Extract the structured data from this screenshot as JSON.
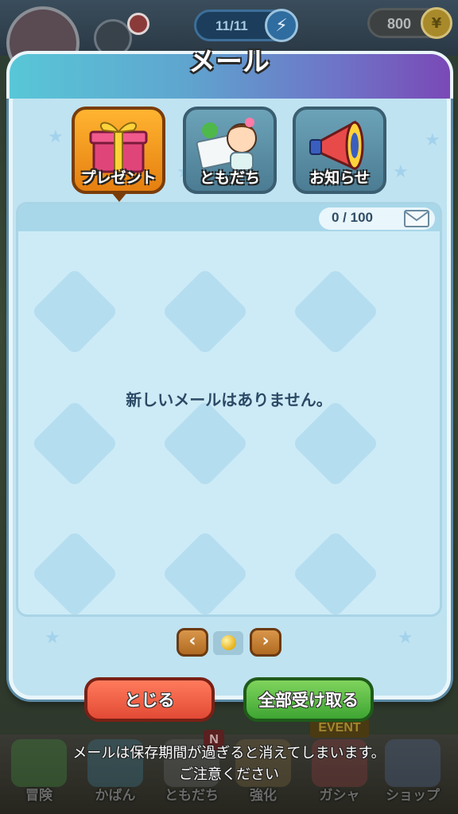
{
  "status_bar": {
    "stamina": "11/11",
    "stamina_icon": "lightning-icon",
    "coins": "800",
    "coin_icon": "yen-coin-icon"
  },
  "modal": {
    "title": "メール",
    "tabs": [
      {
        "label": "プレゼント",
        "icon": "gift-box-icon",
        "active": true
      },
      {
        "label": "ともだち",
        "icon": "friend-letter-icon",
        "active": false
      },
      {
        "label": "お知らせ",
        "icon": "megaphone-icon",
        "active": false
      }
    ],
    "mail_count": "0 / 100",
    "mail_count_icon": "envelope-icon",
    "empty_message": "新しいメールはありません。",
    "pager": {
      "prev_label": "‹",
      "next_label": "›",
      "current_page": 1,
      "total_pages": 1
    },
    "close_button": "とじる",
    "claim_all_button": "全部受け取る",
    "notice_line1": "メールは保存期間が過ぎると消えてしまいます。",
    "notice_line2": "ご注意ください"
  },
  "bottom_nav": {
    "items": [
      {
        "label": "冒険",
        "icon": "map-icon"
      },
      {
        "label": "かばん",
        "icon": "bag-icon"
      },
      {
        "label": "ともだち",
        "icon": "friends-icon"
      },
      {
        "label": "強化",
        "icon": "powerup-icon"
      },
      {
        "label": "ガシャ",
        "icon": "gacha-icon"
      },
      {
        "label": "ショップ",
        "icon": "shop-icon"
      }
    ],
    "event_badge": "EVENT",
    "new_badge": "N"
  },
  "colors": {
    "header_gradient_start": "#58c7d7",
    "header_gradient_end": "#7a49b6",
    "close_button": "#e24a35",
    "claim_button": "#3ea532",
    "active_tab": "#ffb430"
  }
}
